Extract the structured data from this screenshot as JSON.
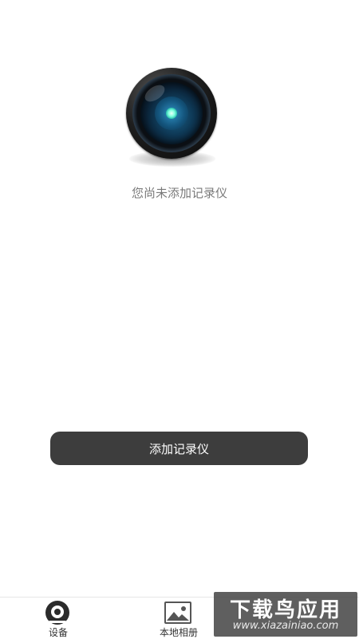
{
  "empty_state": {
    "message": "您尚未添加记录仪",
    "image": "camera-lens-icon"
  },
  "primary_action": {
    "label": "添加记录仪"
  },
  "tabbar": {
    "items": [
      {
        "label": "设备",
        "icon": "device-camera-icon",
        "active": true
      },
      {
        "label": "本地相册",
        "icon": "album-image-icon",
        "active": false
      }
    ]
  },
  "watermark": {
    "title": "下载鸟应用",
    "url": "www.xiazainiao.com"
  },
  "colors": {
    "button_bg": "#3d3d3d",
    "text_muted": "#7a7a7a",
    "tab_active": "#2b2b2b"
  }
}
